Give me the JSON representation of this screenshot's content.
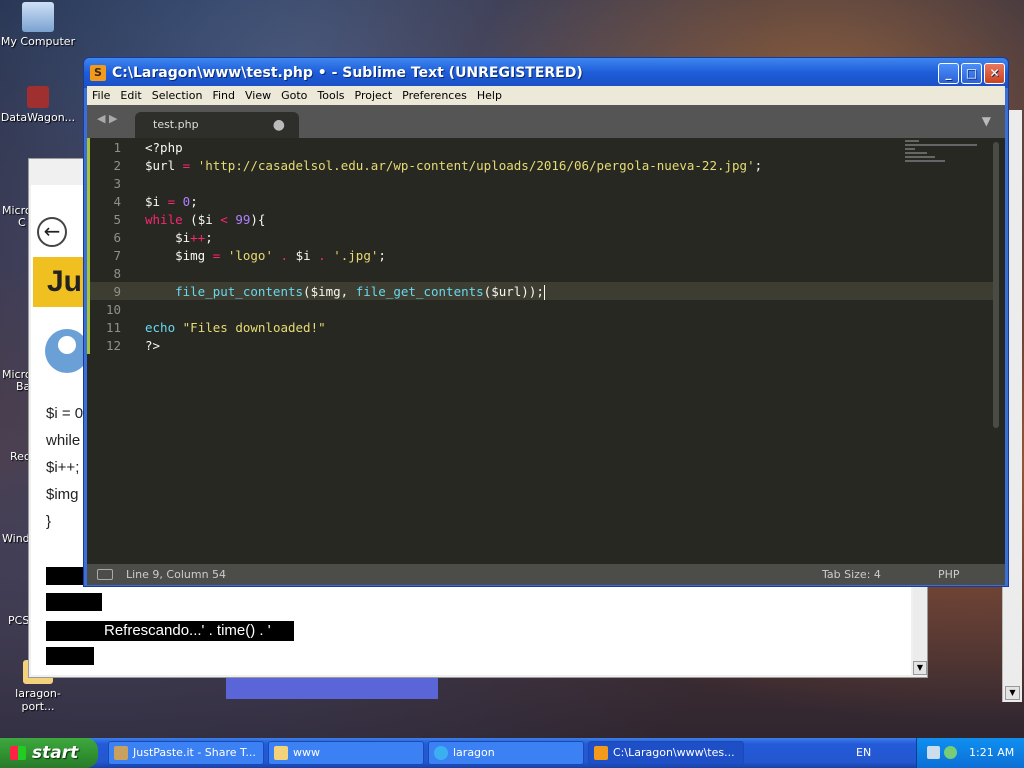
{
  "desktop": {
    "icons": [
      {
        "label": "My Computer"
      },
      {
        "label": "DataWagon..."
      },
      {
        "label": "laragon-port..."
      }
    ],
    "partial_labels": [
      "Micro",
      "C",
      "Micro",
      "Ba",
      "Rec",
      "Windo",
      "PCS"
    ]
  },
  "browser": {
    "back_icon": "←",
    "banner_text": "Jus",
    "code_lines": [
      "$i = 0",
      "while",
      "$i++;",
      "$img",
      "}"
    ],
    "refresh_text": "Refrescando...' . time() . '"
  },
  "sublime": {
    "title": "C:\\Laragon\\www\\test.php • - Sublime Text (UNREGISTERED)",
    "menu": [
      "File",
      "Edit",
      "Selection",
      "Find",
      "View",
      "Goto",
      "Tools",
      "Project",
      "Preferences",
      "Help"
    ],
    "tab": {
      "label": "test.php",
      "modified_dot": "●"
    },
    "line_numbers": [
      "1",
      "2",
      "3",
      "4",
      "5",
      "6",
      "7",
      "8",
      "9",
      "10",
      "11",
      "12"
    ],
    "code": {
      "l1": "<?php",
      "l2_var": "$url",
      "l2_op": "=",
      "l2_str": "'http://casadelsol.edu.ar/wp-content/uploads/2016/06/pergola-nueva-22.jpg'",
      "l2_end": ";",
      "l4_var": "$i",
      "l4_op": "=",
      "l4_num": "0",
      "l4_end": ";",
      "l5_kw": "while",
      "l5_a": " ($i ",
      "l5_op": "<",
      "l5_num": "99",
      "l5_end": "){",
      "l6_var": "    $i",
      "l6_op": "++",
      "l6_end": ";",
      "l7_var": "    $img",
      "l7_op": "=",
      "l7_str1": "'logo'",
      "l7_dot1": ".",
      "l7_mid": "$i",
      "l7_dot2": ".",
      "l7_str2": "'.jpg'",
      "l7_end": ";",
      "l9_fn1": "    file_put_contents",
      "l9_a": "($img, ",
      "l9_fn2": "file_get_contents",
      "l9_b": "($url));",
      "l11_kw": "echo",
      "l11_str": "\"Files downloaded!\"",
      "l12": "?>"
    },
    "status": {
      "position": "Line 9, Column 54",
      "tab_size": "Tab Size: 4",
      "syntax": "PHP"
    }
  },
  "taskbar": {
    "start_label": "start",
    "tasks": [
      {
        "label": "JustPaste.it - Share T..."
      },
      {
        "label": "www"
      },
      {
        "label": "laragon"
      },
      {
        "label": "C:\\Laragon\\www\\tes..."
      }
    ],
    "language": "EN",
    "time": "1:21 AM"
  }
}
